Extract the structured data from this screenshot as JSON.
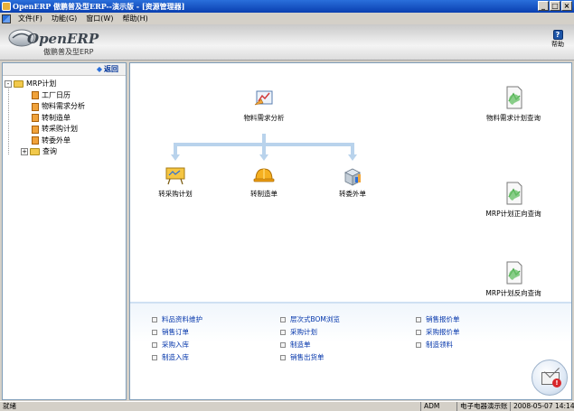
{
  "window": {
    "title": "OpenERP 傲鹏普及型ERP--演示版 - [资源管理器]",
    "controls": [
      "_",
      "□",
      "×"
    ]
  },
  "menu": {
    "items": [
      "文件(F)",
      "功能(G)",
      "窗口(W)",
      "帮助(H)"
    ]
  },
  "header": {
    "logo_text": "OpenERP",
    "logo_sub": "傲鹏普及型ERP",
    "help_label": "帮助",
    "help_glyph": "?"
  },
  "leftpane": {
    "back_label": "返回",
    "tree": [
      {
        "label": "MRP计划",
        "level": 0,
        "type": "folder",
        "expander": "-"
      },
      {
        "label": "工厂日历",
        "level": 1,
        "type": "doc"
      },
      {
        "label": "物料需求分析",
        "level": 1,
        "type": "doc"
      },
      {
        "label": "转制造单",
        "level": 1,
        "type": "doc"
      },
      {
        "label": "转采购计划",
        "level": 1,
        "type": "doc"
      },
      {
        "label": "转委外单",
        "level": 1,
        "type": "doc"
      },
      {
        "label": "查询",
        "level": 1,
        "type": "folder",
        "expander": "+"
      }
    ]
  },
  "flow": {
    "analysis": "物料需求分析",
    "purchase": "转采购计划",
    "manufacture": "转制造单",
    "outsource": "转委外单",
    "query_req": "物料需求计划查询",
    "query_forward": "MRP计划正向查询",
    "query_reverse": "MRP计划反向查询"
  },
  "links": [
    [
      "料品资料维护",
      "层次式BOM浏览",
      "销售报价单"
    ],
    [
      "销售订单",
      "采购计划",
      "采购报价单"
    ],
    [
      "采购入库",
      "制造单",
      "制造领料"
    ],
    [
      "制造入库",
      "销售出货单"
    ]
  ],
  "status": {
    "state": "就绪",
    "user": "ADM",
    "company": "电子电器演示账",
    "datetime": "2008-05-07 14:14:43"
  },
  "colors": {
    "titlebar": "#0a3fb0",
    "accent": "#2a6fdb",
    "flow_line": "#b9d3ec"
  }
}
